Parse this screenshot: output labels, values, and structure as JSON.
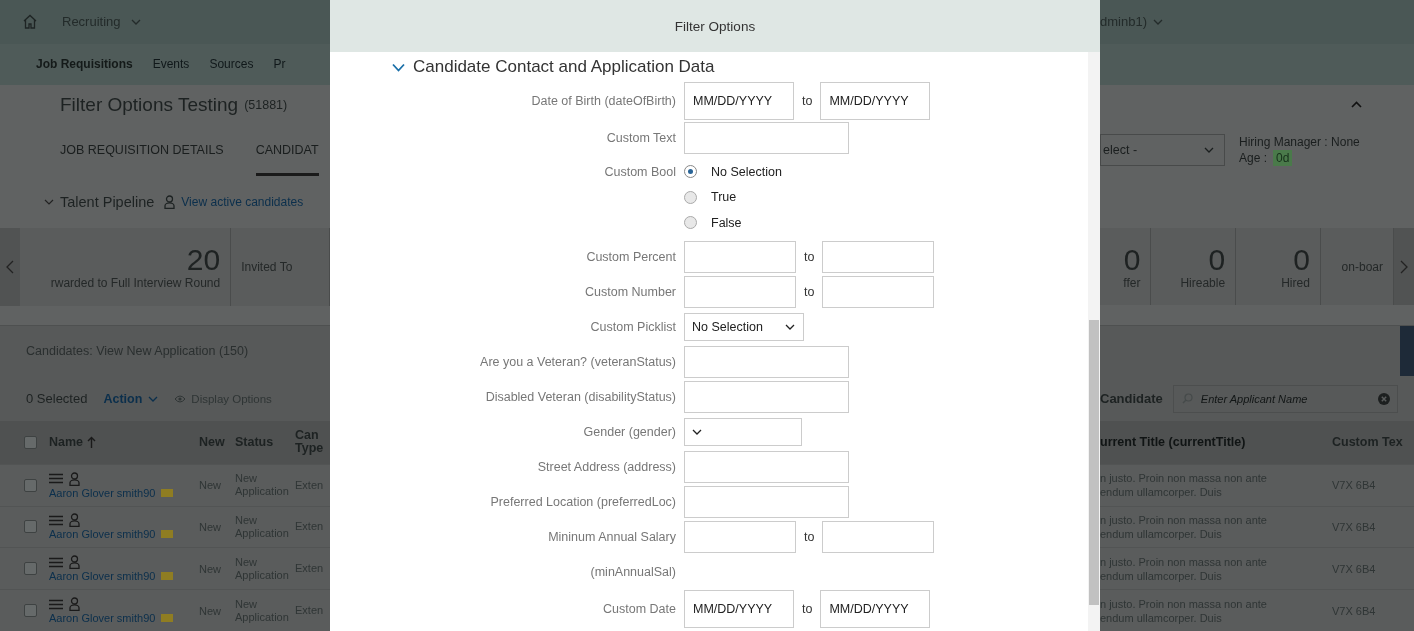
{
  "shell": {
    "app": "Recruiting",
    "user": "dminb1)"
  },
  "nav": [
    {
      "label": "Job Requisitions",
      "selected": true
    },
    {
      "label": "Events",
      "selected": false
    },
    {
      "label": "Sources",
      "selected": false
    },
    {
      "label": "Pr",
      "selected": false
    }
  ],
  "requisition": {
    "title": "Filter Options Testing",
    "count": "(51881)"
  },
  "tabs": [
    {
      "label": "JOB REQUISITION DETAILS",
      "selected": false
    },
    {
      "label": "CANDIDAT",
      "selected": true
    }
  ],
  "status_select": {
    "value": "elect -"
  },
  "hiring_manager": "Hiring Manager : None",
  "age": {
    "label": "Age :",
    "value": "0d"
  },
  "pipeline": {
    "title": "Talent Pipeline",
    "expanded": true,
    "link": "View active candidates",
    "tiles_left": [
      {
        "count": "20",
        "label": "rwarded to Full Interview Round"
      },
      {
        "label": "Invited To"
      }
    ],
    "tiles_right": [
      {
        "count": "0",
        "label": "ffer"
      },
      {
        "count": "0",
        "label": "Hireable"
      },
      {
        "count": "0",
        "label": "Hired"
      },
      {
        "label": "on-boar"
      }
    ]
  },
  "candidates": {
    "title": "Candidates: View New Application (150)",
    "selected": "0 Selected",
    "action": "Action",
    "display": "Display Options",
    "search_label": "Candidate",
    "search_placeholder": "Enter Applicant Name"
  },
  "table": {
    "all_checked": false,
    "columns_left": [
      "Name",
      "New",
      "Status",
      "Can Type"
    ],
    "columns_right": [
      "urrent Title (currentTitle)",
      "Custom Tex"
    ],
    "rows": [
      {
        "checked": false,
        "name": "Aaron Glover smith90",
        "new": "New",
        "status": "New Application",
        "type": "Exten",
        "title": [
          "n justo. Proin non massa non ante",
          "endum ullamcorper. Duis"
        ],
        "custom_text": "V7X 6B4"
      },
      {
        "checked": false,
        "name": "Aaron Glover smith90",
        "new": "New",
        "status": "New Application",
        "type": "Exten",
        "title": [
          "n justo. Proin non massa non ante",
          "endum ullamcorper. Duis"
        ],
        "custom_text": "V7X 6B4"
      },
      {
        "checked": false,
        "name": "Aaron Glover smith90",
        "new": "New",
        "status": "New Application",
        "type": "Exten",
        "title": [
          "n justo. Proin non massa non ante",
          "endum ullamcorper. Duis"
        ],
        "custom_text": "V7X 6B4"
      },
      {
        "checked": false,
        "name": "Aaron Glover smith90",
        "new": "New",
        "status": "New Application",
        "type": "Exten",
        "title": [
          "n justo. Proin non massa non ante",
          "endum ullamcorper. Duis"
        ],
        "custom_text": "V7X 6B4"
      }
    ]
  },
  "filter": {
    "title": "Filter Options",
    "section": {
      "title": "Candidate Contact and Application Data",
      "expanded": true
    },
    "fields": [
      {
        "kind": "date_range",
        "label": "Date of Birth (dateOfBirth)",
        "from_placeholder": "MM/DD/YYYY",
        "separator": "to",
        "to_placeholder": "MM/DD/YYYY"
      },
      {
        "kind": "text",
        "label": "Custom Text"
      },
      {
        "kind": "radio",
        "label": "Custom Bool",
        "options": [
          {
            "label": "No Selection",
            "selected": true
          },
          {
            "label": "True",
            "selected": false
          },
          {
            "label": "False",
            "selected": false
          }
        ]
      },
      {
        "kind": "range",
        "label": "Custom Percent",
        "separator": "to"
      },
      {
        "kind": "range",
        "label": "Custom Number",
        "separator": "to"
      },
      {
        "kind": "select",
        "label": "Custom Picklist",
        "value": "No Selection"
      },
      {
        "kind": "text",
        "label": "Are you a Veteran? (veteranStatus)"
      },
      {
        "kind": "text",
        "label": "Disabled Veteran (disabilityStatus)"
      },
      {
        "kind": "select",
        "label": "Gender (gender)"
      },
      {
        "kind": "text",
        "label": "Street Address (address)"
      },
      {
        "kind": "text",
        "label": "Preferred Location (preferredLoc)"
      },
      {
        "kind": "range",
        "label": "Mininum Annual Salary",
        "separator": "to",
        "label_note": "(minAnnualSal)"
      },
      {
        "kind": "date_range",
        "label": "Custom Date",
        "from_placeholder": "MM/DD/YYYY",
        "separator": "to",
        "to_placeholder": "MM/DD/YYYY"
      }
    ]
  }
}
